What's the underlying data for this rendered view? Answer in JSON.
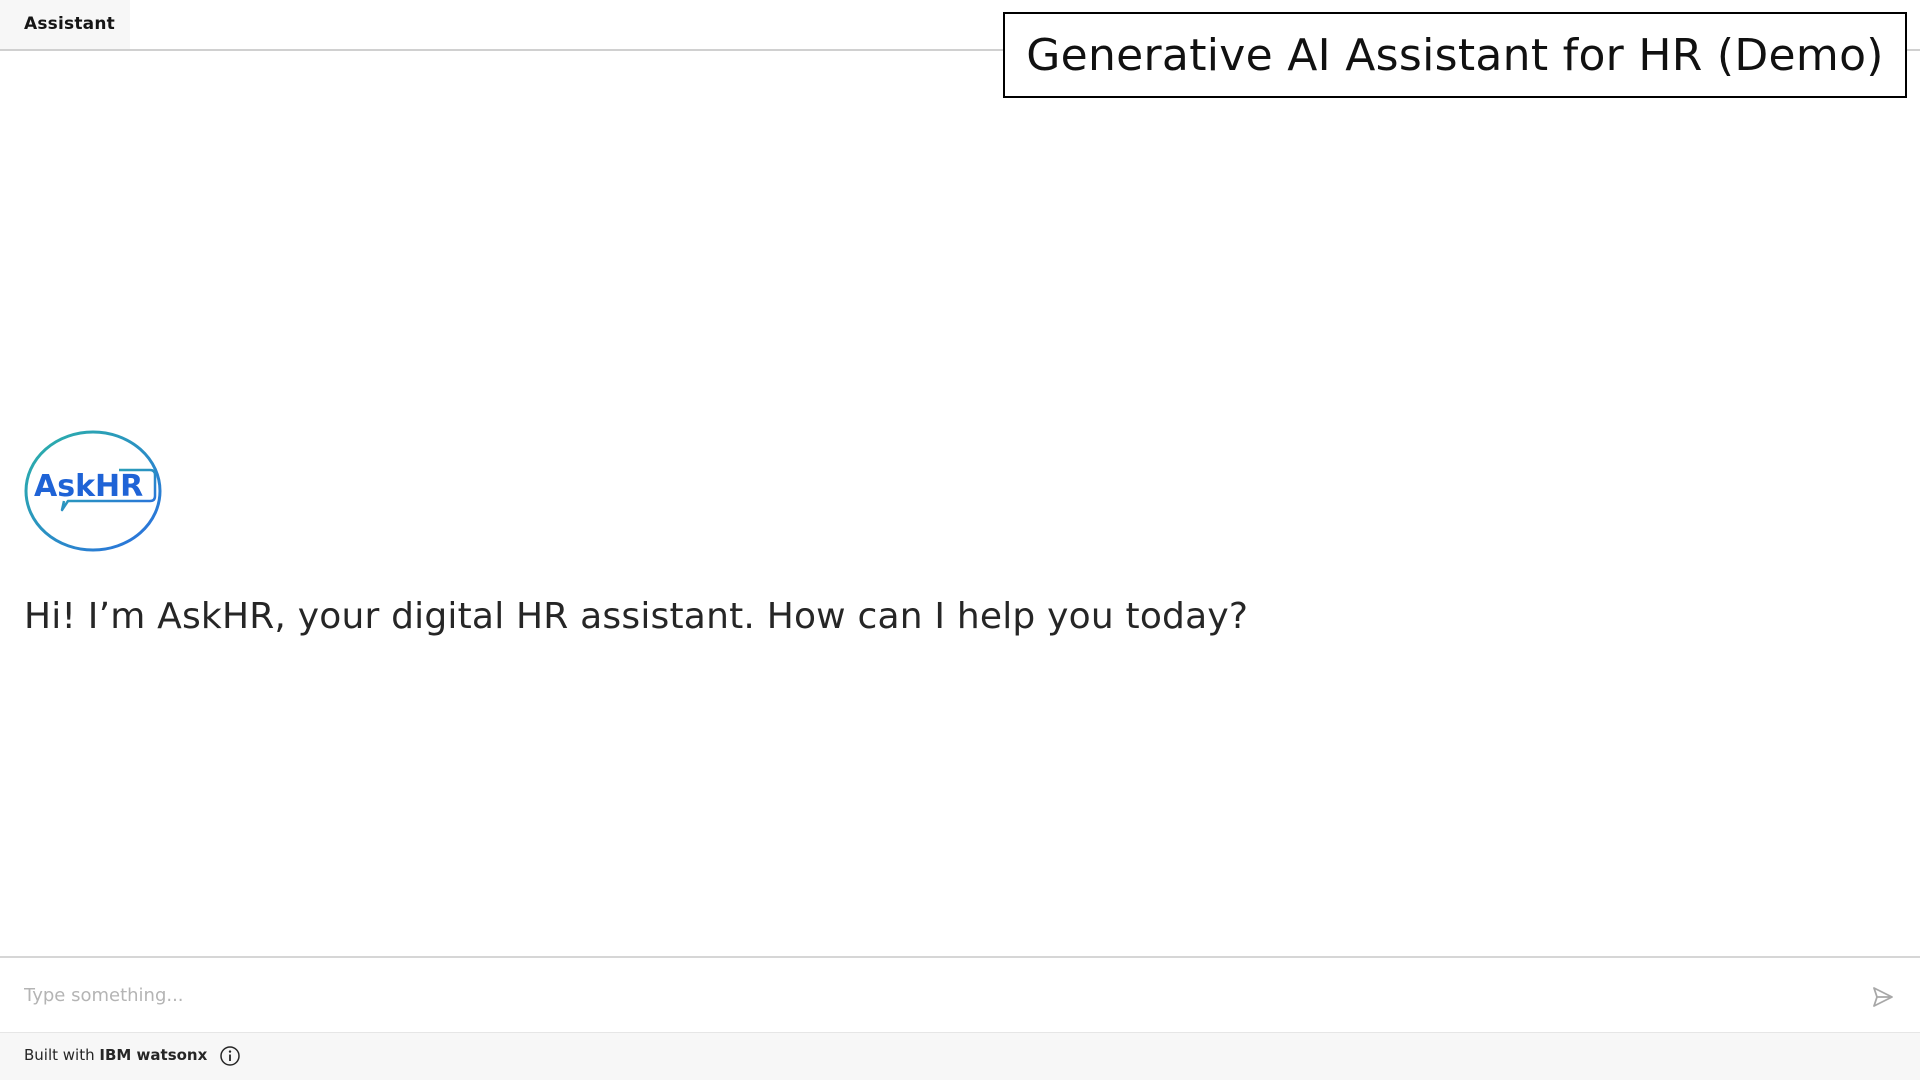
{
  "header": {
    "title": "Assistant"
  },
  "caption": {
    "text": "Generative AI Assistant for HR (Demo)"
  },
  "avatar": {
    "logo_text": "AskHR",
    "icon": "askhr-logo-icon",
    "colors": {
      "ring_start": "#2bb3a6",
      "ring_end": "#2a6ee0",
      "text": "#1f63d6"
    }
  },
  "messages": [
    {
      "sender": "assistant",
      "text": "Hi! I’m AskHR, your digital HR assistant. How can I help you today?"
    }
  ],
  "input": {
    "value": "",
    "placeholder": "Type something..."
  },
  "send": {
    "icon": "send-icon"
  },
  "footer": {
    "built_with": "Built with",
    "brand": "IBM watsonx",
    "info_icon": "info-icon"
  }
}
